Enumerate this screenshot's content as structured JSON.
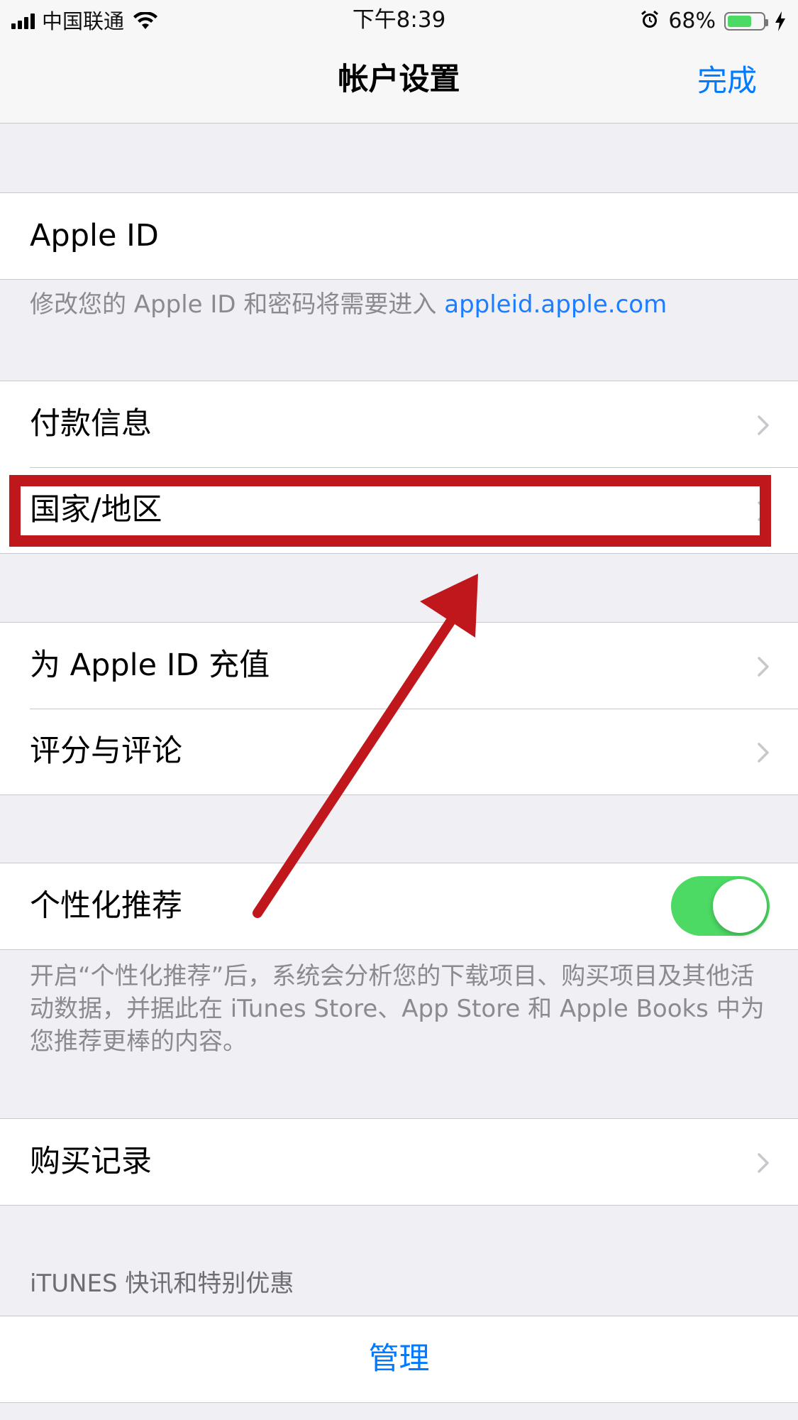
{
  "status_bar": {
    "carrier": "中国联通",
    "time": "下午8:39",
    "battery_percent": "68%",
    "battery_level": 0.68,
    "icons": [
      "signal-icon",
      "wifi-icon",
      "alarm-icon",
      "battery-icon",
      "charging-bolt-icon"
    ]
  },
  "nav": {
    "title": "帐户设置",
    "done_label": "完成"
  },
  "apple_id": {
    "label": "Apple ID",
    "footnote_prefix": "修改您的 Apple ID 和密码将需要进入 ",
    "footnote_link": "appleid.apple.com"
  },
  "group_payment": {
    "items": [
      {
        "label": "付款信息"
      },
      {
        "label": "国家/地区"
      }
    ]
  },
  "group_recharge": {
    "items": [
      {
        "label": "为 Apple ID 充值"
      },
      {
        "label": "评分与评论"
      }
    ]
  },
  "personalized": {
    "label": "个性化推荐",
    "enabled": true,
    "footnote": "开启“个性化推荐”后，系统会分析您的下载项目、购买项目及其他活动数据，并据此在 iTunes Store、App Store 和 Apple Books 中为您推荐更棒的内容。"
  },
  "purchase_history": {
    "label": "购买记录"
  },
  "itunes_section": {
    "header": "iTUNES 快讯和特别优惠",
    "manage_label": "管理"
  },
  "colors": {
    "accent": "#007aff",
    "toggle_on": "#4cd964",
    "annotation_red": "#c0171d",
    "background": "#efeff4"
  }
}
